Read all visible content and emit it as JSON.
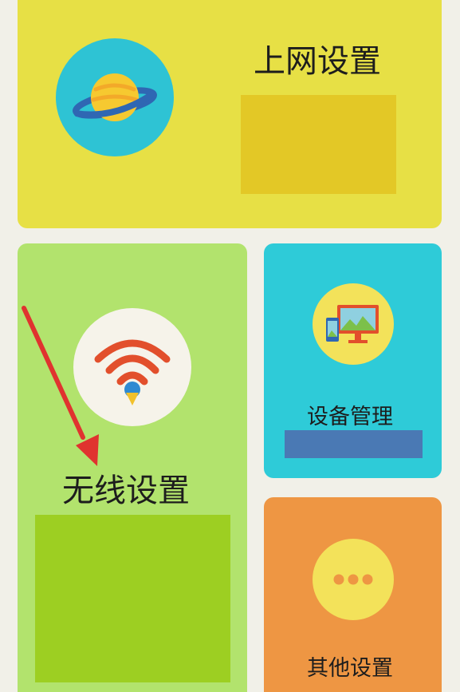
{
  "tiles": {
    "internet": {
      "label": "上网设置",
      "icon": "planet-icon",
      "color": "#e7e045",
      "accent_block_color": "#e3c826"
    },
    "wireless": {
      "label": "无线设置",
      "icon": "wifi-icon",
      "color": "#b2e36d",
      "accent_block_color": "#9dcf22"
    },
    "device": {
      "label": "设备管理",
      "icon": "devices-icon",
      "color": "#2ecbd8",
      "accent_block_color": "#4a79b4"
    },
    "other": {
      "label": "其他设置",
      "icon": "more-dots-icon",
      "color": "#ee9643"
    }
  },
  "annotation": {
    "icon": "red-arrow-icon",
    "color": "#e0332f"
  }
}
